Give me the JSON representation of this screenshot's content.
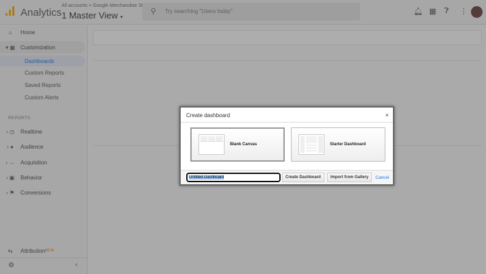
{
  "header": {
    "app_name": "Analytics",
    "breadcrumb": "All accounts > Google Merchandise St...",
    "view": "1 Master View",
    "search_placeholder": "Try searching \"Users today\""
  },
  "sidebar": {
    "home": "Home",
    "customization": "Customization",
    "custom_items": [
      "Dashboards",
      "Custom Reports",
      "Saved Reports",
      "Custom Alerts"
    ],
    "section_reports": "REPORTS",
    "reports": [
      "Realtime",
      "Audience",
      "Acquisition",
      "Behavior",
      "Conversions"
    ],
    "attribution": "Attribution",
    "beta": "BETA"
  },
  "dialog": {
    "title": "Create dashboard",
    "close": "×",
    "options": [
      "Blank Canvas",
      "Starter Dashboard"
    ],
    "name_value": "Untitled Dashboard",
    "create_label": "Create Dashboard",
    "import_label": "Import from Gallery",
    "cancel_label": "Cancel"
  },
  "colors": {
    "accent": "#1a73e8",
    "logo": "#f9ab00",
    "overlay": "rgba(60,60,60,0.42)"
  }
}
